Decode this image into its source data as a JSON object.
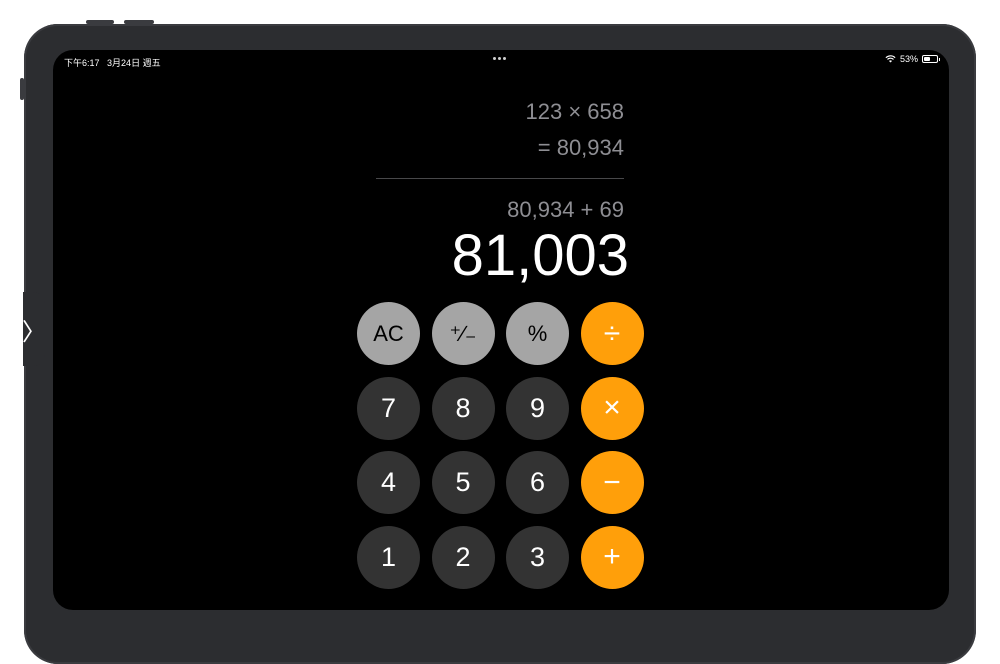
{
  "status": {
    "time": "下午6:17",
    "date": "3月24日 週五",
    "battery_text": "53%",
    "battery_level": 0.53
  },
  "display": {
    "history": [
      {
        "expression": "123 × 658",
        "result": "= 80,934"
      }
    ],
    "current_expression": "80,934 + 69",
    "result": "81,003"
  },
  "keypad": {
    "row1": [
      {
        "label": "AC",
        "type": "func",
        "name": "clear-button"
      },
      {
        "label": "⁺∕₋",
        "type": "func",
        "name": "plus-minus-button"
      },
      {
        "label": "%",
        "type": "func",
        "name": "percent-button"
      },
      {
        "label": "÷",
        "type": "op",
        "name": "divide-button"
      }
    ],
    "row2": [
      {
        "label": "7",
        "type": "num",
        "name": "digit-7-button"
      },
      {
        "label": "8",
        "type": "num",
        "name": "digit-8-button"
      },
      {
        "label": "9",
        "type": "num",
        "name": "digit-9-button"
      },
      {
        "label": "×",
        "type": "op",
        "name": "multiply-button"
      }
    ],
    "row3": [
      {
        "label": "4",
        "type": "num",
        "name": "digit-4-button"
      },
      {
        "label": "5",
        "type": "num",
        "name": "digit-5-button"
      },
      {
        "label": "6",
        "type": "num",
        "name": "digit-6-button"
      },
      {
        "label": "−",
        "type": "op",
        "name": "minus-button"
      }
    ],
    "row4": [
      {
        "label": "1",
        "type": "num",
        "name": "digit-1-button"
      },
      {
        "label": "2",
        "type": "num",
        "name": "digit-2-button"
      },
      {
        "label": "3",
        "type": "num",
        "name": "digit-3-button"
      },
      {
        "label": "+",
        "type": "op",
        "name": "plus-button"
      }
    ]
  },
  "side_handle": {
    "label": "〉"
  },
  "colors": {
    "operator": "#ff9f0a",
    "function": "#a5a5a5",
    "number": "#333333",
    "background": "#000000"
  }
}
